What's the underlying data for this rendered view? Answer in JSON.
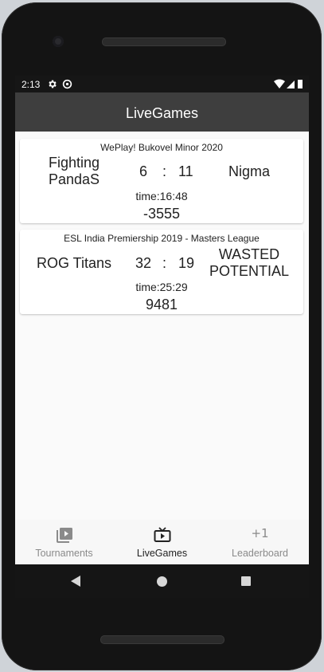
{
  "status_bar": {
    "time": "2:13"
  },
  "app_bar": {
    "title": "LiveGames"
  },
  "games": [
    {
      "tournament": "WePlay! Bukovel Minor 2020",
      "team_left": "Fighting PandaS",
      "score_left": "6",
      "separator": ":",
      "score_right": "11",
      "team_right": "Nigma",
      "time_label": "time:16:48",
      "net_worth": "-3555"
    },
    {
      "tournament": "ESL India Premiership 2019 - Masters League",
      "team_left": "ROG Titans",
      "score_left": "32",
      "separator": ":",
      "score_right": "19",
      "team_right": "WASTED POTENTIAL",
      "time_label": "time:25:29",
      "net_worth": "9481"
    }
  ],
  "bottom_nav": {
    "items": [
      {
        "label": "Tournaments",
        "icon": "video-library-icon"
      },
      {
        "label": "LiveGames",
        "icon": "live-tv-icon"
      },
      {
        "label": "Leaderboard",
        "icon": "plus-one-icon",
        "glyph": "+1"
      }
    ],
    "active": "LiveGames"
  },
  "colors": {
    "app_bar": "#3e3e3e",
    "status_bar": "#161616",
    "background": "#fafafa",
    "active_label": "#222222",
    "inactive_label": "#8a8a8a"
  }
}
